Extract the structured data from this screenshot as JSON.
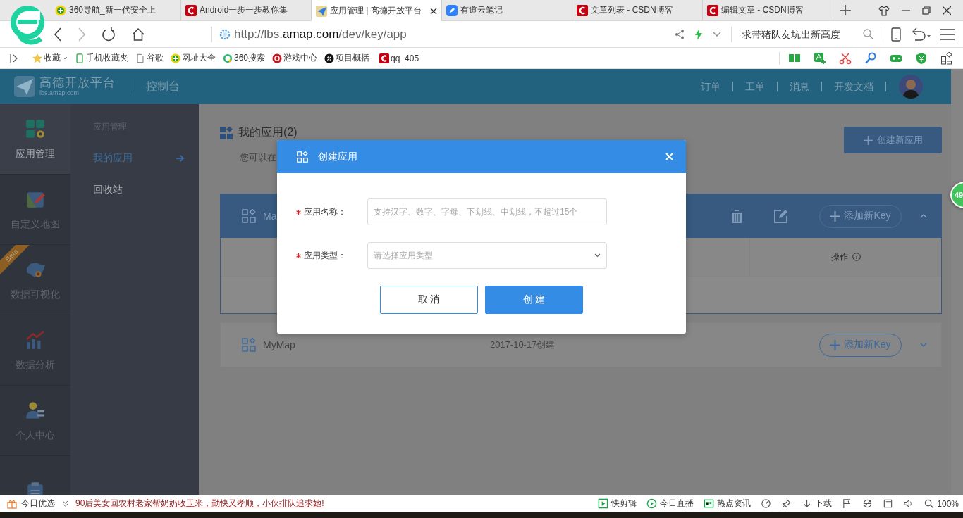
{
  "browser": {
    "tabs": [
      {
        "label": "360导航_新一代安全上",
        "kind": "nav360",
        "selected": false
      },
      {
        "label": "Android一步一步教你集",
        "kind": "csdn",
        "selected": false
      },
      {
        "label": "应用管理 | 高德开放平台",
        "kind": "amap",
        "selected": true
      },
      {
        "label": "有道云笔记",
        "kind": "note",
        "selected": false
      },
      {
        "label": "文章列表 - CSDN博客",
        "kind": "csdn",
        "selected": false
      },
      {
        "label": "编辑文章 - CSDN博客",
        "kind": "csdn",
        "selected": false
      }
    ],
    "address": {
      "url": [
        {
          "text": "http://lbs.",
          "kind": "dim"
        },
        {
          "text": "amap.com",
          "kind": "host"
        },
        {
          "text": "/dev/key/app",
          "kind": "dim"
        }
      ]
    },
    "search": {
      "placeholder": "求带猪队友坑出新高度"
    },
    "bookmarks": [
      {
        "label": "收藏",
        "kind": "star",
        "menu": true
      },
      {
        "label": "手机收藏夹",
        "kind": "phone",
        "menu": false
      },
      {
        "label": "谷歌",
        "kind": "page",
        "menu": false
      },
      {
        "label": "网址大全",
        "kind": "nav360",
        "menu": false
      },
      {
        "label": "360搜索",
        "kind": "ring",
        "menu": false
      },
      {
        "label": "游戏中心",
        "kind": "game",
        "menu": false
      },
      {
        "label": "项目概括-",
        "kind": "dark",
        "menu": false
      },
      {
        "label": "qq_405",
        "kind": "csdn",
        "menu": false
      }
    ]
  },
  "app": {
    "header": {
      "brand": "高德开放平台",
      "brand_url": "lbs.amap.com",
      "console": "控制台",
      "nav": [
        "订单",
        "工单",
        "消息",
        "开发文档"
      ]
    },
    "sidebar": [
      {
        "label": "应用管理",
        "kind": "apps",
        "selected": true
      },
      {
        "label": "自定义地图",
        "kind": "map",
        "selected": false
      },
      {
        "label": "数据可视化",
        "kind": "china",
        "selected": false,
        "badge": "Beta"
      },
      {
        "label": "数据分析",
        "kind": "chart",
        "selected": false
      },
      {
        "label": "个人中心",
        "kind": "person",
        "selected": false
      },
      {
        "kind": "clipboard",
        "selected": false
      }
    ],
    "subnav": {
      "heading": "应用管理",
      "items": [
        {
          "label": "我的应用",
          "selected": true
        },
        {
          "label": "回收站",
          "selected": false
        }
      ]
    },
    "main": {
      "title": "我的应用(2)",
      "subtitle": "您可以在",
      "create_button": "创建新应用",
      "apps": [
        {
          "name": "Ma",
          "expanded": true,
          "add_key": "添加新Key",
          "columns": [
            {
              "label": "操作",
              "info": true
            }
          ]
        },
        {
          "name": "MyMap",
          "created": "2017-10-17创建",
          "expanded": false,
          "add_key": "添加新Key"
        }
      ]
    }
  },
  "dialog": {
    "title": "创建应用",
    "fields": [
      {
        "kind": "text",
        "label": "应用名称：",
        "required": true,
        "placeholder": "支持汉字、数字、字母、下划线、中划线，不超过15个"
      },
      {
        "kind": "select",
        "label": "应用类型：",
        "required": true,
        "placeholder": "请选择应用类型"
      }
    ],
    "buttons": [
      {
        "label": "取 消",
        "kind": "secondary"
      },
      {
        "label": "创 建",
        "kind": "primary"
      }
    ]
  },
  "float_badge": "49",
  "status_bar": {
    "label": "今日优选",
    "headline": "90后美女回农村老家帮奶奶收玉米，勤快又孝顺，小伙排队追求她!",
    "items": [
      {
        "kind": "clip",
        "label": "快剪辑"
      },
      {
        "kind": "live",
        "label": "今日直播"
      },
      {
        "kind": "news",
        "label": "热点资讯"
      },
      {
        "kind": "speed"
      },
      {
        "kind": "pin"
      },
      {
        "kind": "download",
        "label": "下载"
      },
      {
        "kind": "flag"
      },
      {
        "kind": "ie"
      },
      {
        "kind": "window"
      },
      {
        "kind": "sound"
      },
      {
        "kind": "zoom",
        "label": "100%"
      }
    ]
  }
}
